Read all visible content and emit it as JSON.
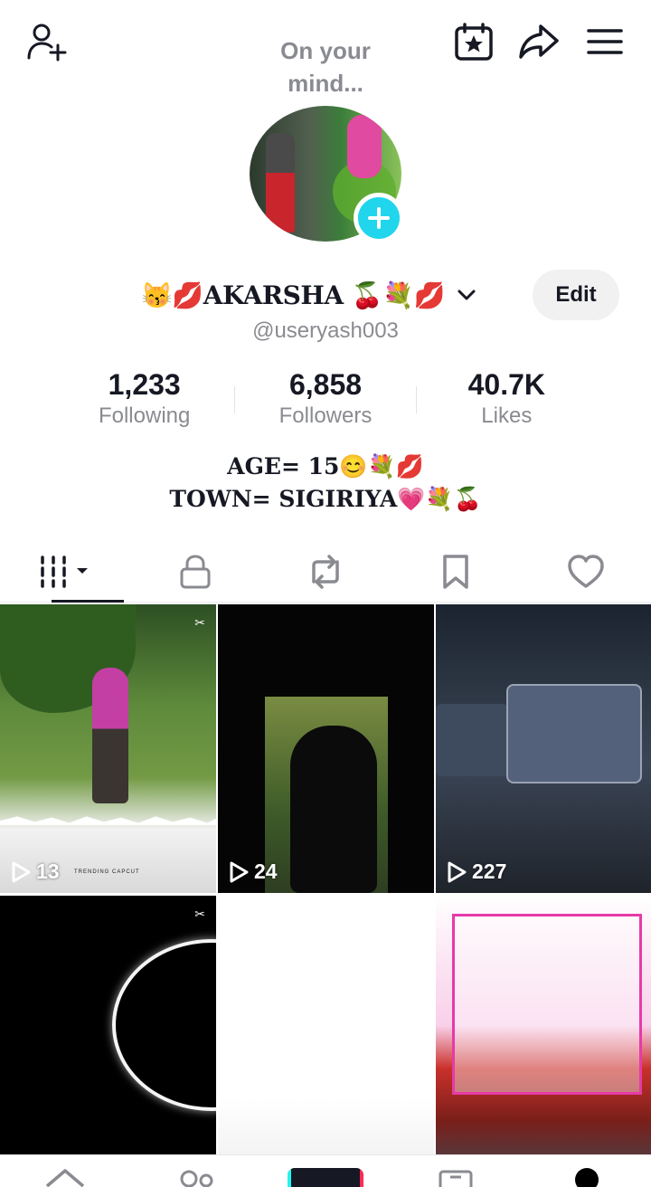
{
  "header": {
    "mind_note": "On your mind...",
    "icons": [
      "add-friend-icon",
      "calendar-star-icon",
      "share-icon",
      "menu-icon"
    ]
  },
  "profile": {
    "display_name": "😽💋AKARSHA 🍒💐💋",
    "username": "@useryash003",
    "edit_label": "Edit"
  },
  "stats": [
    {
      "value": "1,233",
      "label": "Following"
    },
    {
      "value": "6,858",
      "label": "Followers"
    },
    {
      "value": "40.7K",
      "label": "Likes"
    }
  ],
  "bio": {
    "line1": "AGE= 15😊💐💋",
    "line2": "TOWN= SIGIRIYA💗💐🍒"
  },
  "tabs": [
    "videos-tab",
    "private-tab",
    "reposts-tab",
    "favorites-tab",
    "liked-tab"
  ],
  "videos": [
    {
      "views": "13",
      "overlay": "TRENDING CAPCUT"
    },
    {
      "views": "24"
    },
    {
      "views": "227"
    }
  ],
  "colors": {
    "accent": "#20d5ec",
    "text_primary": "#161823",
    "text_secondary": "#8a8b91",
    "button_bg": "#f1f1f2"
  }
}
